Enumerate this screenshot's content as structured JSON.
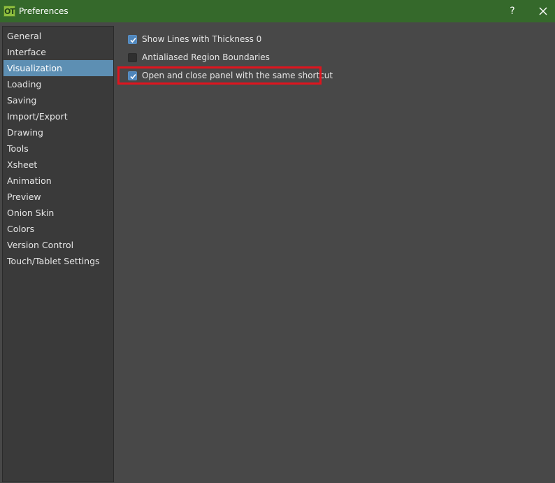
{
  "window": {
    "title": "Preferences",
    "app_icon_text": "OT",
    "help_label": "?",
    "close_icon": "close-icon"
  },
  "sidebar": {
    "items": [
      {
        "label": "General",
        "selected": false
      },
      {
        "label": "Interface",
        "selected": false
      },
      {
        "label": "Visualization",
        "selected": true
      },
      {
        "label": "Loading",
        "selected": false
      },
      {
        "label": "Saving",
        "selected": false
      },
      {
        "label": "Import/Export",
        "selected": false
      },
      {
        "label": "Drawing",
        "selected": false
      },
      {
        "label": "Tools",
        "selected": false
      },
      {
        "label": "Xsheet",
        "selected": false
      },
      {
        "label": "Animation",
        "selected": false
      },
      {
        "label": "Preview",
        "selected": false
      },
      {
        "label": "Onion Skin",
        "selected": false
      },
      {
        "label": "Colors",
        "selected": false
      },
      {
        "label": "Version Control",
        "selected": false
      },
      {
        "label": "Touch/Tablet Settings",
        "selected": false
      }
    ]
  },
  "visualization": {
    "options": [
      {
        "label": "Show Lines with Thickness 0",
        "checked": true
      },
      {
        "label": "Antialiased Region Boundaries",
        "checked": false
      },
      {
        "label": "Open and close panel with the same shortcut",
        "checked": true,
        "highlighted": true
      }
    ]
  },
  "colors": {
    "titlebar": "#35692b",
    "selected_item": "#5d8fb3",
    "checkbox_checked": "#4f86bc",
    "highlight_border": "#e0141e"
  }
}
